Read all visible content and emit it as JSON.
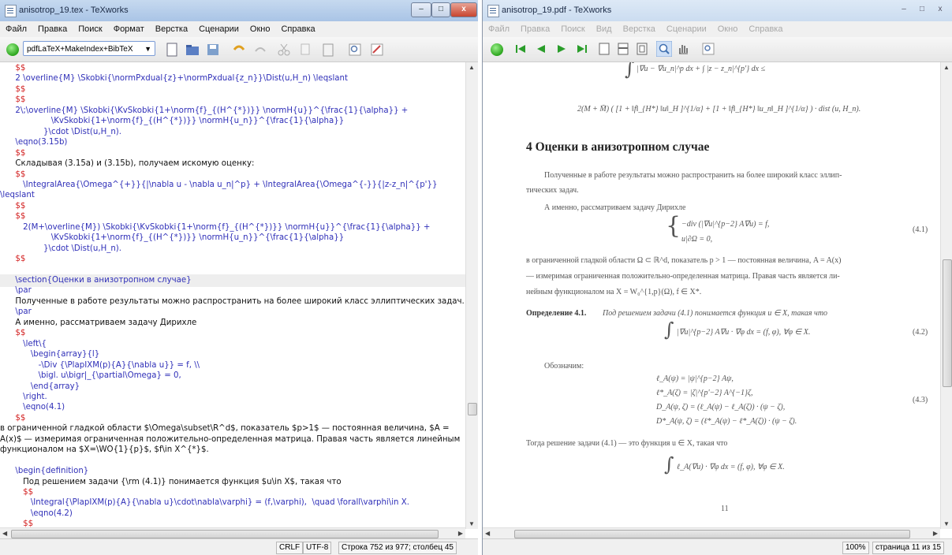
{
  "editor": {
    "title": "anisotrop_19.tex - TeXworks",
    "menu": [
      "Файл",
      "Правка",
      "Поиск",
      "Формат",
      "Верстка",
      "Сценарии",
      "Окно",
      "Справка"
    ],
    "engine": "pdfLaTeX+MakeIndex+BibTeX",
    "lines": [
      {
        "text": "      $$",
        "kind": "dollar"
      },
      {
        "text": "      2 \\overline{M} \\Skobki{\\normPxdual{z}+\\normPxdual{z_n}}\\Dist(u,H_n) \\leqslant",
        "kind": "cmd"
      },
      {
        "text": "      $$",
        "kind": "dollar"
      },
      {
        "text": "      $$",
        "kind": "dollar"
      },
      {
        "text": "      2\\;\\overline{M} \\Skobki{\\KvSkobki{1+\\norm{f}_{(H^{*})}} \\normH{u}}^{\\frac{1}{\\alpha}} +",
        "kind": "cmd"
      },
      {
        "text": "                    \\KvSkobki{1+\\norm{f}_{(H^{*})}} \\normH{u_n}}^{\\frac{1}{\\alpha}}",
        "kind": "cmd"
      },
      {
        "text": "                 }\\cdot \\Dist(u,H_n).",
        "kind": "cmd"
      },
      {
        "text": "      \\eqno(3.15b)",
        "kind": "cmd"
      },
      {
        "text": "      $$",
        "kind": "dollar"
      },
      {
        "text": "      Складывая (3.15a) и (3.15b), получаем искомую оценку:",
        "kind": "txt"
      },
      {
        "text": "      $$",
        "kind": "dollar"
      },
      {
        "text": "         \\IntegralArea{\\Omega^{+}}{|\\nabla u - \\nabla u_n|^p} + \\IntegralArea{\\Omega^{-}}{|z-z_n|^{p'}}",
        "kind": "cmd"
      },
      {
        "text": "\\leqslant",
        "kind": "cmd"
      },
      {
        "text": "      $$",
        "kind": "dollar"
      },
      {
        "text": "      $$",
        "kind": "dollar"
      },
      {
        "text": "         2(M+\\overline{M}) \\Skobki{\\KvSkobki{1+\\norm{f}_{(H^{*})}} \\normH{u}}^{\\frac{1}{\\alpha}} +",
        "kind": "cmd"
      },
      {
        "text": "                    \\KvSkobki{1+\\norm{f}_{(H^{*})}} \\normH{u_n}}^{\\frac{1}{\\alpha}}",
        "kind": "cmd"
      },
      {
        "text": "                 }\\cdot \\Dist(u,H_n).",
        "kind": "cmd"
      },
      {
        "text": "      $$",
        "kind": "dollar"
      },
      {
        "text": "",
        "kind": "txt"
      },
      {
        "text": "      \\section{Оценки в анизотропном случае}",
        "kind": "cmd",
        "highlight": true
      },
      {
        "text": "      \\par",
        "kind": "cmd"
      },
      {
        "text": "      Полученные в работе результаты можно распространить на более широкий класс эллиптических задач.",
        "kind": "txt"
      },
      {
        "text": "      \\par",
        "kind": "cmd"
      },
      {
        "text": "      А именно, рассматриваем задачу Дирихле",
        "kind": "txt"
      },
      {
        "text": "      $$",
        "kind": "dollar"
      },
      {
        "text": "         \\left\\{",
        "kind": "cmd"
      },
      {
        "text": "            \\begin{array}{l}",
        "kind": "cmd"
      },
      {
        "text": "               -\\Div {\\PlapIXM(p){A}{\\nabla u}} = f, \\\\",
        "kind": "cmd"
      },
      {
        "text": "               \\bigl. u\\bigr|_{\\partial\\Omega} = 0,",
        "kind": "cmd"
      },
      {
        "text": "            \\end{array}",
        "kind": "cmd"
      },
      {
        "text": "         \\right.",
        "kind": "cmd"
      },
      {
        "text": "         \\eqno(4.1)",
        "kind": "cmd"
      },
      {
        "text": "      $$",
        "kind": "dollar"
      },
      {
        "text": "в ограниченной гладкой области $\\Omega\\subset\\R^d$, показатель $p>1$ — постоянная величина, $A =",
        "kind": "txt"
      },
      {
        "text": "A(x)$ — измеримая ограниченная положительно-определенная матрица. Правая часть является линейным",
        "kind": "txt"
      },
      {
        "text": "функционалом на $X=\\WO{1}{p}$, $f\\in X^{*}$.",
        "kind": "txt"
      },
      {
        "text": "",
        "kind": "txt"
      },
      {
        "text": "      \\begin{definition}",
        "kind": "cmd"
      },
      {
        "text": "         Под решением задачи {\\rm (4.1)} понимается функция $u\\in X$, такая что",
        "kind": "txt"
      },
      {
        "text": "         $$",
        "kind": "dollar"
      },
      {
        "text": "            \\Integral{\\PlapIXM(p){A}{\\nabla u}\\cdot\\nabla\\varphi} = (f,\\varphi),  \\quad \\forall\\varphi\\in X.",
        "kind": "cmd"
      },
      {
        "text": "            \\eqno(4.2)",
        "kind": "cmd"
      },
      {
        "text": "         $$",
        "kind": "dollar"
      }
    ],
    "status": {
      "eol": "CRLF",
      "encoding": "UTF-8",
      "position": "Строка 752 из 977; столбец 45"
    }
  },
  "pdf": {
    "title": "anisotrop_19.pdf - TeXworks",
    "menu": [
      "Файл",
      "Правка",
      "Поиск",
      "Вид",
      "Верстка",
      "Сценарии",
      "Окно",
      "Справка"
    ],
    "heading": "4   Оценки в анизотропном случае",
    "para1": [
      "Полученные в работе результаты можно распространить на более широкий класс эллип-",
      "тических задач."
    ],
    "para2": "А именно, рассматриваем задачу Дирихле",
    "sys_lines": [
      "−div (|∇u|^{p−2} A∇u) = f,",
      "u|∂Ω = 0,"
    ],
    "eq41": "(4.1)",
    "para3": [
      "в ограниченной гладкой области Ω ⊂ ℝ^d, показатель p > 1 — постоянная величина, A = A(x)",
      "— измеримая ограниченная положительно-определенная матрица. Правая часть является ли-",
      "нейным функционалом на X = W₀^{1,p}(Ω), f ∈ X*."
    ],
    "def_label": "Определение 4.1.",
    "def_text": "Под решением задачи (4.1) понимается функция u ∈ X, такая что",
    "eq42": "|∇u|^{p−2} A∇u · ∇φ dx = (f, φ),   ∀φ ∈ X.",
    "eq42_no": "(4.2)",
    "notation": "Обозначим:",
    "eq43_lines": [
      "ℓ_A(ψ) = |ψ|^{p−2} Aψ,",
      "ℓ*_A(ζ) = |ζ|^{p'−2} A^{−1}ζ,",
      "D_A(ψ, ζ) = (ℓ_A(ψ) − ℓ_A(ζ)) · (ψ − ζ),",
      "D*_A(ψ, ζ) = (ℓ*_A(ψ) − ℓ*_A(ζ)) · (ψ − ζ)."
    ],
    "eq43_no": "(4.3)",
    "then": "Тогда решение задачи (4.1) — это функция u ∈ X, такая что",
    "eq_last": "ℓ_A(∇u) · ∇φ dx = (f, φ),   ∀φ ∈ X.",
    "top_eq1": "|∇u − ∇u_n|^p dx + ∫ |z − z_n|^{p'} dx ≤",
    "top_eq2": "2(M + M̄) ( [1 + ‖f‖_{H*} ‖u‖_H ]^{1/α} + [1 + ‖f‖_{H*} ‖u_n‖_H ]^{1/α} ) · dist (u, H_n).",
    "page_no": "11",
    "status": {
      "zoom": "100%",
      "page": "страница 11 из 15"
    }
  }
}
